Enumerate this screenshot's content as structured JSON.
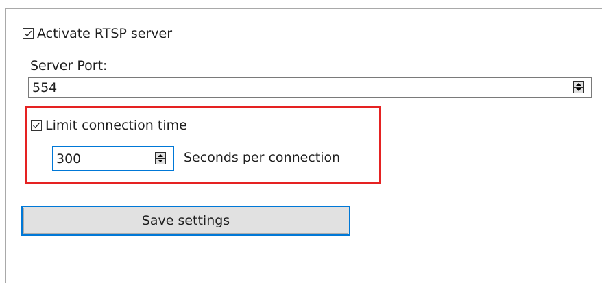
{
  "rtsp": {
    "activate_label": "Activate RTSP server",
    "activate_checked": true
  },
  "server_port": {
    "label": "Server Port:",
    "value": "554"
  },
  "limit": {
    "label": "Limit connection time",
    "checked": true,
    "seconds_value": "300",
    "suffix_label": "Seconds per connection"
  },
  "save_button": {
    "label": "Save settings"
  },
  "colors": {
    "highlight_border": "#e52222",
    "focus_accent": "#0078d7",
    "button_face": "#e1e1e1"
  },
  "icons": {
    "checkmark": "checkmark-icon",
    "spinner_up": "up-arrow-icon",
    "spinner_down": "down-arrow-icon"
  }
}
